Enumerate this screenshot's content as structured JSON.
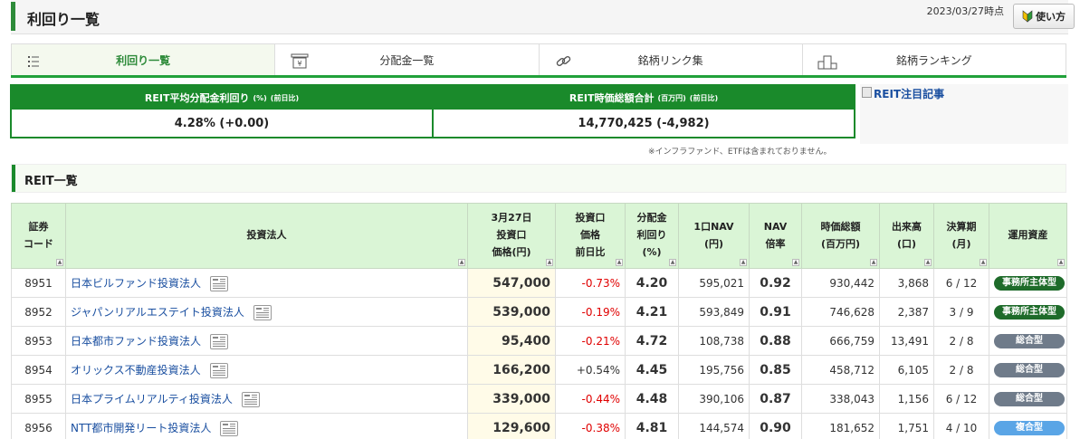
{
  "header": {
    "title": "利回り一覧",
    "as_of": "2023/03/27時点",
    "help_label": "使い方"
  },
  "tabs": [
    {
      "label": "利回り一覧",
      "icon": "list-icon",
      "active": true
    },
    {
      "label": "分配金一覧",
      "icon": "yen-register-icon",
      "active": false
    },
    {
      "label": "銘柄リンク集",
      "icon": "link-icon",
      "active": false
    },
    {
      "label": "銘柄ランキング",
      "icon": "podium-icon",
      "active": false
    }
  ],
  "summary": {
    "avg_yield": {
      "label": "REIT平均分配金利回り",
      "unit": "(%)",
      "note": "(前日比)",
      "value": "4.28% (+0.00)"
    },
    "market_cap": {
      "label": "REIT時価総額合計",
      "unit": "(百万円)",
      "note": "(前日比)",
      "value": "14,770,425 (-4,982)"
    }
  },
  "featured_article_alt": "REIT注目記事",
  "note": "※インフラファンド、ETFは含まれておりません。",
  "list_title": "REIT一覧",
  "table": {
    "columns": [
      "証券\nコード",
      "投資法人",
      "3月27日\n投資口\n価格(円)",
      "投資口\n価格\n前日比",
      "分配金\n利回り\n(%)",
      "1口NAV\n(円)",
      "NAV\n倍率",
      "時価総額\n(百万円)",
      "出来高\n(口)",
      "決算期\n(月)",
      "運用資産"
    ],
    "rows": [
      {
        "code": "8951",
        "name": "日本ビルファンド投資法人",
        "price": "547,000",
        "change": "-0.73%",
        "yield": "4.20",
        "nav": "595,021",
        "nav_ratio": "0.92",
        "mcap": "930,442",
        "volume": "3,868",
        "period": "6 / 12",
        "asset": "事務所主体型",
        "asset_color": "#1e6b2a"
      },
      {
        "code": "8952",
        "name": "ジャパンリアルエステイト投資法人",
        "price": "539,000",
        "change": "-0.19%",
        "yield": "4.21",
        "nav": "593,849",
        "nav_ratio": "0.91",
        "mcap": "746,628",
        "volume": "2,387",
        "period": "3 / 9",
        "asset": "事務所主体型",
        "asset_color": "#1e6b2a"
      },
      {
        "code": "8953",
        "name": "日本都市ファンド投資法人",
        "price": "95,400",
        "change": "-0.21%",
        "yield": "4.72",
        "nav": "108,738",
        "nav_ratio": "0.88",
        "mcap": "666,759",
        "volume": "13,491",
        "period": "2 / 8",
        "asset": "総合型",
        "asset_color": "#6f7b8a"
      },
      {
        "code": "8954",
        "name": "オリックス不動産投資法人",
        "price": "166,200",
        "change": "+0.54%",
        "yield": "4.45",
        "nav": "195,756",
        "nav_ratio": "0.85",
        "mcap": "458,712",
        "volume": "6,105",
        "period": "2 / 8",
        "asset": "総合型",
        "asset_color": "#6f7b8a"
      },
      {
        "code": "8955",
        "name": "日本プライムリアルティ投資法人",
        "price": "339,000",
        "change": "-0.44%",
        "yield": "4.48",
        "nav": "390,106",
        "nav_ratio": "0.87",
        "mcap": "338,043",
        "volume": "1,156",
        "period": "6 / 12",
        "asset": "総合型",
        "asset_color": "#6f7b8a"
      },
      {
        "code": "8956",
        "name": "NTT都市開発リート投資法人",
        "price": "129,600",
        "change": "-0.38%",
        "yield": "4.81",
        "nav": "144,574",
        "nav_ratio": "0.90",
        "mcap": "181,652",
        "volume": "1,751",
        "period": "4 / 10",
        "asset": "複合型",
        "asset_color": "#5aa5e6"
      }
    ]
  },
  "colors": {
    "brand_green": "#1a8a2b",
    "accent_green": "#21a13a",
    "negative": "#e00000",
    "link": "#1a4fa0"
  }
}
